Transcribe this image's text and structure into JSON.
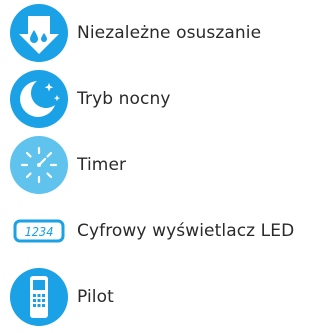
{
  "features": [
    {
      "label": "Niezależne osuszanie",
      "icon": "water-drop-arrow-icon"
    },
    {
      "label": "Tryb nocny",
      "icon": "moon-stars-icon"
    },
    {
      "label": "Timer",
      "icon": "timer-icon"
    },
    {
      "label": "Cyfrowy wyświetlacz LED",
      "icon": "led-display-icon",
      "display_text": "1234"
    },
    {
      "label": "Pilot",
      "icon": "remote-control-icon"
    }
  ],
  "colors": {
    "accent": "#1aa1e6",
    "text": "#2a2a2a"
  }
}
